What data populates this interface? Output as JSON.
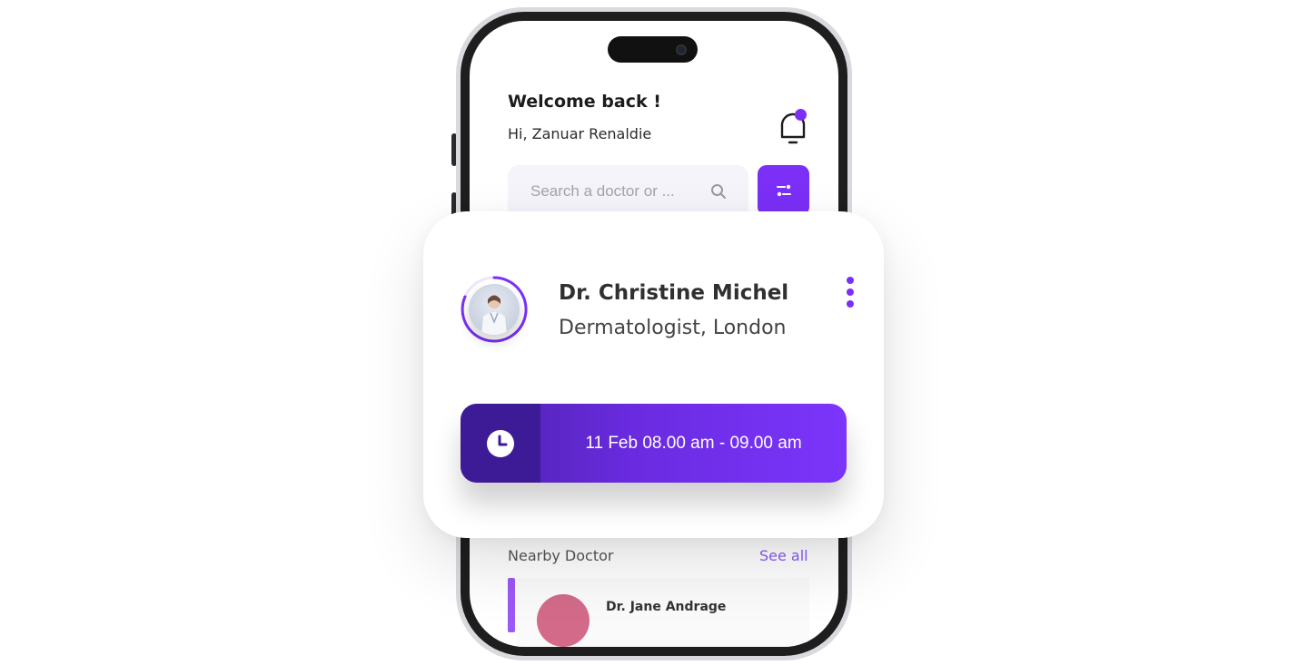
{
  "header": {
    "welcome": "Welcome back !",
    "greeting": "Hi, Zanuar Renaldie"
  },
  "search": {
    "placeholder": "Search a doctor or ..."
  },
  "appointment_card": {
    "doctor_name": "Dr. Christine Michel",
    "doctor_role": "Dermatologist, London",
    "time": "11 Feb 08.00 am - 09.00 am"
  },
  "nearby": {
    "title": "Nearby Doctor",
    "see_all": "See all",
    "items": [
      {
        "name": "Dr. Jane Andrage"
      }
    ]
  },
  "colors": {
    "accent": "#7b2ff7",
    "appointment_dark": "#3e1b96"
  },
  "icons": [
    "bell-icon",
    "search-icon",
    "filter-icon",
    "more-vertical-icon",
    "clock-icon"
  ]
}
